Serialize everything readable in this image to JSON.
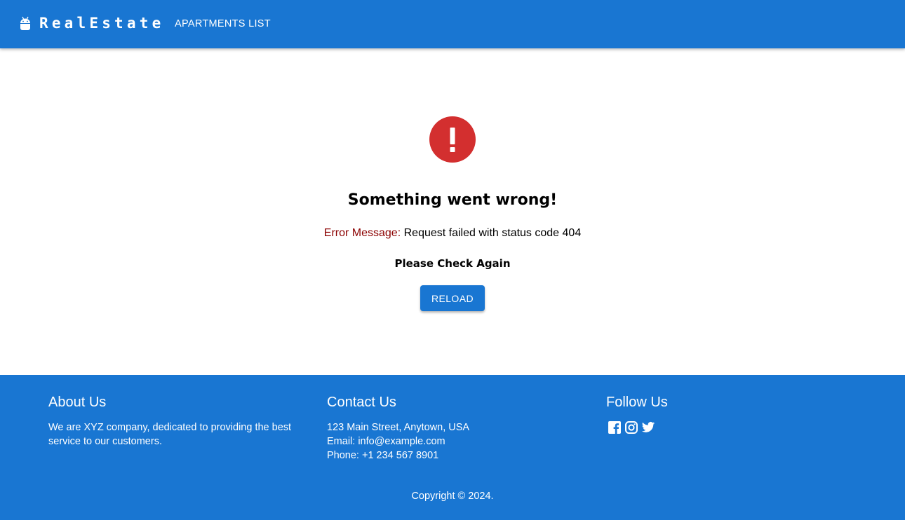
{
  "header": {
    "brand": "RealEstate",
    "nav_link": "APARTMENTS LIST"
  },
  "error": {
    "title": "Something went wrong!",
    "message_label": "Error Message:",
    "message_text": "Request failed with status code 404",
    "hint": "Please Check Again",
    "reload_label": "RELOAD"
  },
  "footer": {
    "about": {
      "title": "About Us",
      "text": "We are XYZ company, dedicated to providing the best service to our customers."
    },
    "contact": {
      "title": "Contact Us",
      "address": "123 Main Street, Anytown, USA",
      "email": "Email: info@example.com",
      "phone": "Phone: +1 234 567 8901"
    },
    "follow": {
      "title": "Follow Us",
      "icons": [
        "facebook-icon",
        "instagram-icon",
        "twitter-icon"
      ]
    },
    "copyright": "Copyright © 2024."
  },
  "colors": {
    "primary": "#1976d2",
    "error": "#d32f2f",
    "error_label": "#8b0000"
  }
}
